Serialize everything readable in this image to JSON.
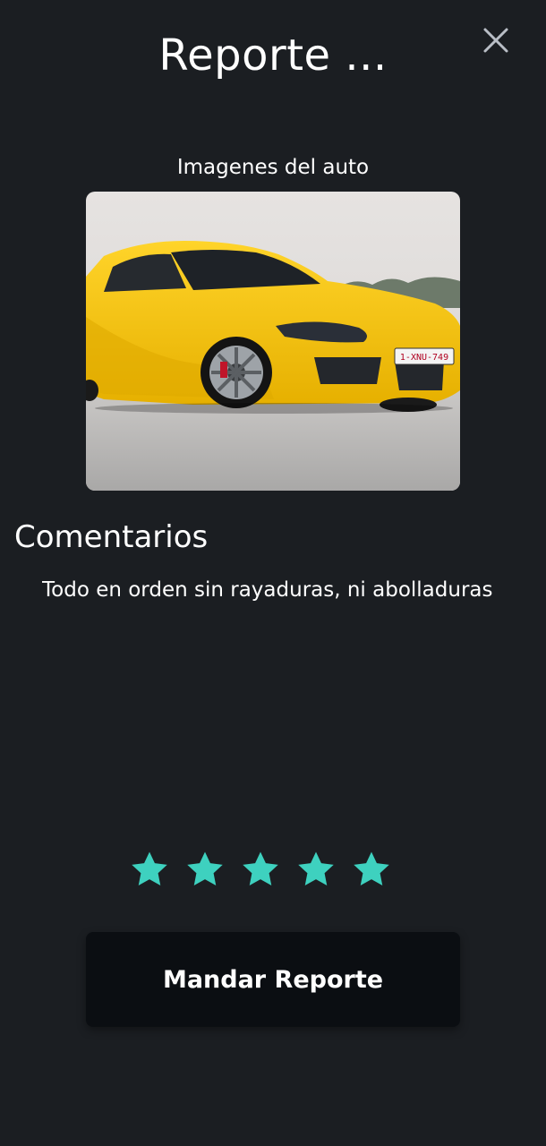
{
  "header": {
    "title": "Reporte ...",
    "close_icon": "close-icon"
  },
  "images_section": {
    "label": "Imagenes del auto",
    "photo_description": "yellow sports car photo",
    "license_plate": "1-XNU-749"
  },
  "comments": {
    "title": "Comentarios",
    "value": "Todo en orden sin rayaduras, ni abolladuras"
  },
  "rating": {
    "value": 5,
    "max": 5,
    "color": "#3ed1bf"
  },
  "submit": {
    "label": "Mandar Reporte"
  },
  "colors": {
    "background": "#1b1e22",
    "button": "#0b0e12",
    "accent": "#3ed1bf"
  }
}
